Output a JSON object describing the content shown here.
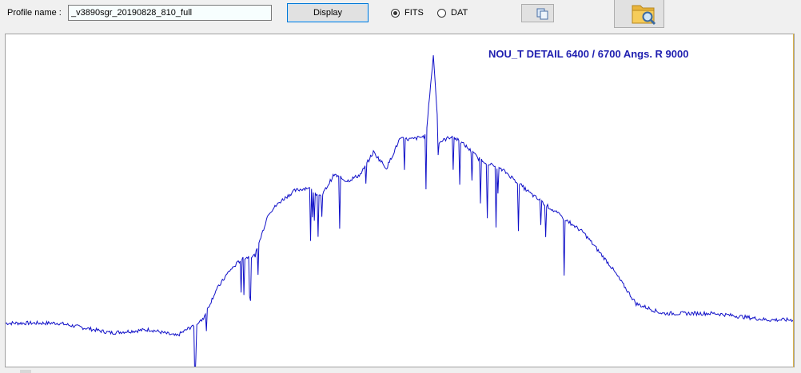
{
  "toolbar": {
    "profile_label": "Profile name :",
    "profile_value": "_v3890sgr_20190828_810_full",
    "display_button": "Display",
    "radio_fits": "FITS",
    "radio_dat": "DAT",
    "selected_format": "FITS",
    "copy_icon": "copy-icon",
    "open_icon": "folder-search-icon"
  },
  "plot": {
    "title": "NOU_T  DETAIL  6400 / 6700 Angs.  R 9000",
    "line_color": "#1010c8",
    "title_color": "#2020b0"
  },
  "chart_data": {
    "type": "line",
    "title": "NOU_T  DETAIL  6400 / 6700 Angs.  R 9000",
    "xlabel": "",
    "ylabel": "",
    "xlim": [
      6400,
      6700
    ],
    "ylim": [
      0,
      1
    ],
    "grid": false,
    "series": [
      {
        "x": [
          6400,
          6420,
          6440,
          6455,
          6465,
          6475,
          6480,
          6485,
          6490,
          6495,
          6500,
          6505,
          6510,
          6515,
          6520,
          6525,
          6530,
          6535,
          6540,
          6545,
          6550,
          6555,
          6560,
          6562.8,
          6565,
          6570,
          6575,
          6580,
          6590,
          6600,
          6610,
          6620,
          6630,
          6640,
          6650,
          6660,
          6670,
          6680,
          6690,
          6700
        ],
        "y": [
          0.12,
          0.12,
          0.09,
          0.1,
          0.08,
          0.13,
          0.22,
          0.28,
          0.32,
          0.33,
          0.46,
          0.5,
          0.53,
          0.54,
          0.51,
          0.58,
          0.56,
          0.58,
          0.65,
          0.6,
          0.69,
          0.69,
          0.7,
          0.95,
          0.68,
          0.7,
          0.67,
          0.63,
          0.59,
          0.52,
          0.46,
          0.4,
          0.3,
          0.18,
          0.15,
          0.15,
          0.15,
          0.14,
          0.13,
          0.13
        ]
      }
    ]
  }
}
